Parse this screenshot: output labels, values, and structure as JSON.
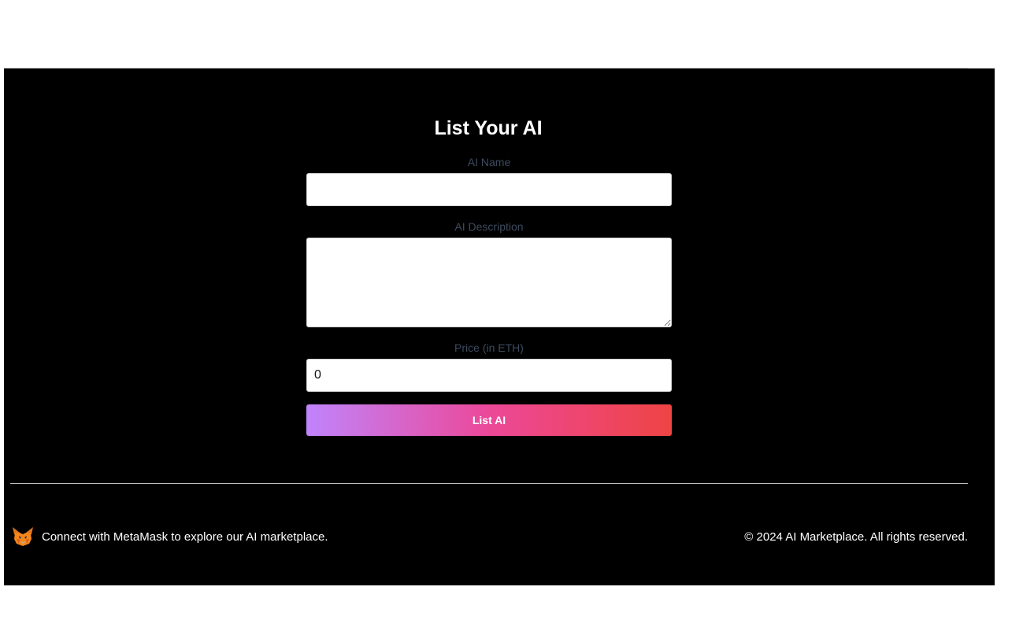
{
  "form": {
    "title": "List Your AI",
    "name_label": "AI Name",
    "name_value": "",
    "description_label": "AI Description",
    "description_value": "",
    "price_label": "Price (in ETH)",
    "price_value": "0",
    "submit_label": "List AI"
  },
  "footer": {
    "connect_text": "Connect with MetaMask to explore our AI marketplace.",
    "copyright": "© 2024 AI Marketplace. All rights reserved.",
    "icon": "metamask-fox-icon"
  },
  "colors": {
    "background": "#000000",
    "gradient_start": "#c084fc",
    "gradient_mid": "#ec4899",
    "gradient_end": "#ef4444",
    "label": "#3e4a5e"
  }
}
